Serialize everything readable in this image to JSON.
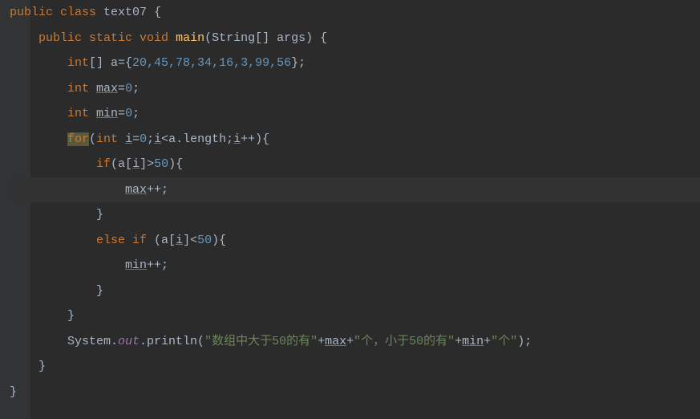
{
  "code": {
    "class_kw": "public class",
    "class_name": "text07",
    "brace_open": " {",
    "method_sig_kw": "public static void",
    "method_name": "main",
    "method_params": "(String[] args) {",
    "decl_int_arr": "int",
    "arr_brackets": "[] a={",
    "arr_vals": "20,45,78,34,16,3,99,56",
    "arr_close": "};",
    "decl_max": "int ",
    "max_var": "max",
    "eq_zero1": "=",
    "zero1": "0",
    "semi": ";",
    "decl_min": "int ",
    "min_var": "min",
    "eq_zero2": "=",
    "zero2": "0",
    "for_kw": "for",
    "for_open": "(",
    "for_int": "int ",
    "for_i": "i",
    "for_eq": "=",
    "for_zero": "0",
    "for_semi1": ";",
    "for_i2": "i",
    "for_lt": "<a.length;",
    "for_i3": "i",
    "for_inc": "++){",
    "if_kw": "if",
    "if_open": "(a[",
    "if_i": "i",
    "if_close": "]>",
    "fifty1": "50",
    "if_brace": "){",
    "max_inc_var": "max",
    "inc_op": "++;",
    "brace_close1": "}",
    "else_kw": "else if",
    "else_open": " (a[",
    "else_i": "i",
    "else_close": "]<",
    "fifty2": "50",
    "else_brace": "){",
    "min_inc_var": "min",
    "brace_close2": "}",
    "brace_close3": "}",
    "sys": "System.",
    "out": "out",
    "println": ".println(",
    "str1": "\"数组中大于50的有\"",
    "plus1": "+",
    "max_ref": "max",
    "plus2": "+",
    "str2": "\"个，小于50的有\"",
    "plus3": "+",
    "min_ref": "min",
    "plus4": "+",
    "str3": "\"个\"",
    "println_close": ");",
    "brace_close4": "}",
    "brace_close5": "}"
  }
}
